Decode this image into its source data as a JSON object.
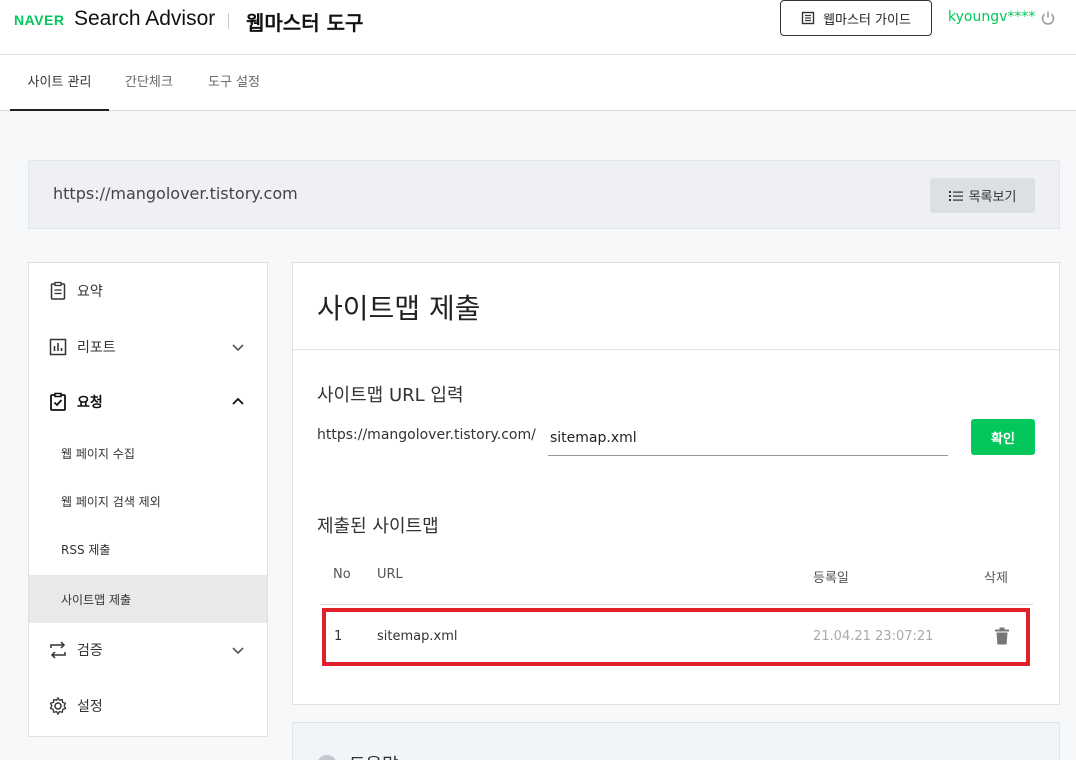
{
  "header": {
    "logo": "NAVER",
    "brand": "Search Advisor",
    "subtitle": "웹마스터 도구",
    "guide_button": "웹마스터 가이드",
    "user": "kyoungv****"
  },
  "tabs": [
    {
      "label": "사이트 관리",
      "active": true
    },
    {
      "label": "간단체크",
      "active": false
    },
    {
      "label": "도구 설정",
      "active": false
    }
  ],
  "site": {
    "url": "https://mangolover.tistory.com",
    "list_button": "목록보기"
  },
  "sidebar": {
    "items": [
      {
        "label": "요약",
        "icon": "clipboard-icon"
      },
      {
        "label": "리포트",
        "icon": "chart-icon"
      },
      {
        "label": "요청",
        "icon": "clipboard-check-icon"
      },
      {
        "label": "검증",
        "icon": "swap-icon"
      },
      {
        "label": "설정",
        "icon": "gear-icon"
      }
    ],
    "sub_items": [
      {
        "label": "웹 페이지 수집"
      },
      {
        "label": "웹 페이지 검색 제외"
      },
      {
        "label": "RSS 제출"
      },
      {
        "label": "사이트맵 제출",
        "active": true
      }
    ]
  },
  "main": {
    "title": "사이트맵 제출",
    "input_section": "사이트맵 URL 입력",
    "url_prefix": "https://mangolover.tistory.com/",
    "input_value": "sitemap.xml",
    "confirm_button": "확인",
    "submitted_section": "제출된 사이트맵",
    "table": {
      "headers": [
        "No",
        "URL",
        "등록일",
        "삭제"
      ],
      "rows": [
        {
          "no": "1",
          "url": "sitemap.xml",
          "date": "21.04.21 23:07:21"
        }
      ]
    },
    "highlight_color": "#e2202a"
  },
  "help": {
    "label": "도움말"
  },
  "colors": {
    "accent": "#03c75a"
  }
}
